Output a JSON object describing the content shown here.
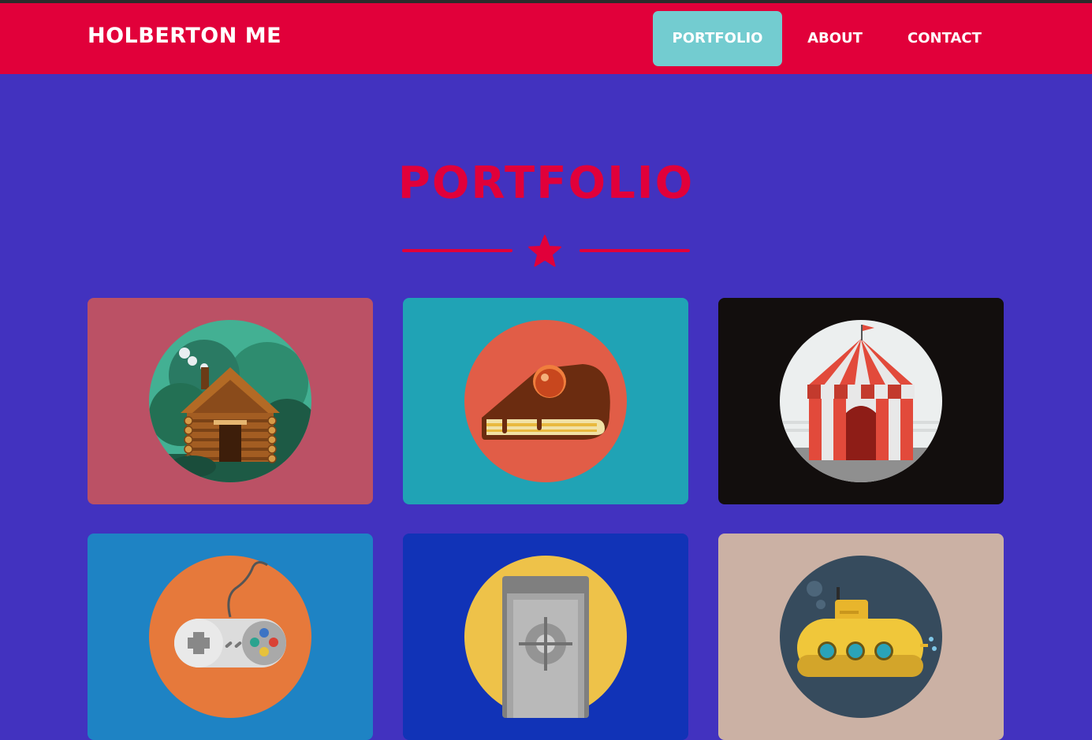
{
  "brand": "HOLBERTON ME",
  "nav": {
    "items": [
      {
        "label": "PORTFOLIO",
        "active": true
      },
      {
        "label": "ABOUT",
        "active": false
      },
      {
        "label": "CONTACT",
        "active": false
      }
    ]
  },
  "section": {
    "title": "PORTFOLIO",
    "divider_icon": "star-icon"
  },
  "portfolio": {
    "items": [
      {
        "icon": "log-cabin-icon",
        "bg": "#bb5165"
      },
      {
        "icon": "cake-slice-icon",
        "bg": "#20a3b5"
      },
      {
        "icon": "circus-tent-icon",
        "bg": "#120e0d"
      },
      {
        "icon": "game-controller-icon",
        "bg": "#1e83c4"
      },
      {
        "icon": "safe-icon",
        "bg": "#1133b7"
      },
      {
        "icon": "submarine-icon",
        "bg": "#cbb1a4"
      }
    ]
  },
  "colors": {
    "page_bg": "#4232bf",
    "navbar_bg": "#e1003a",
    "active_nav_bg": "#73ccd0",
    "accent": "#e1003a",
    "text_light": "#ffffff"
  }
}
